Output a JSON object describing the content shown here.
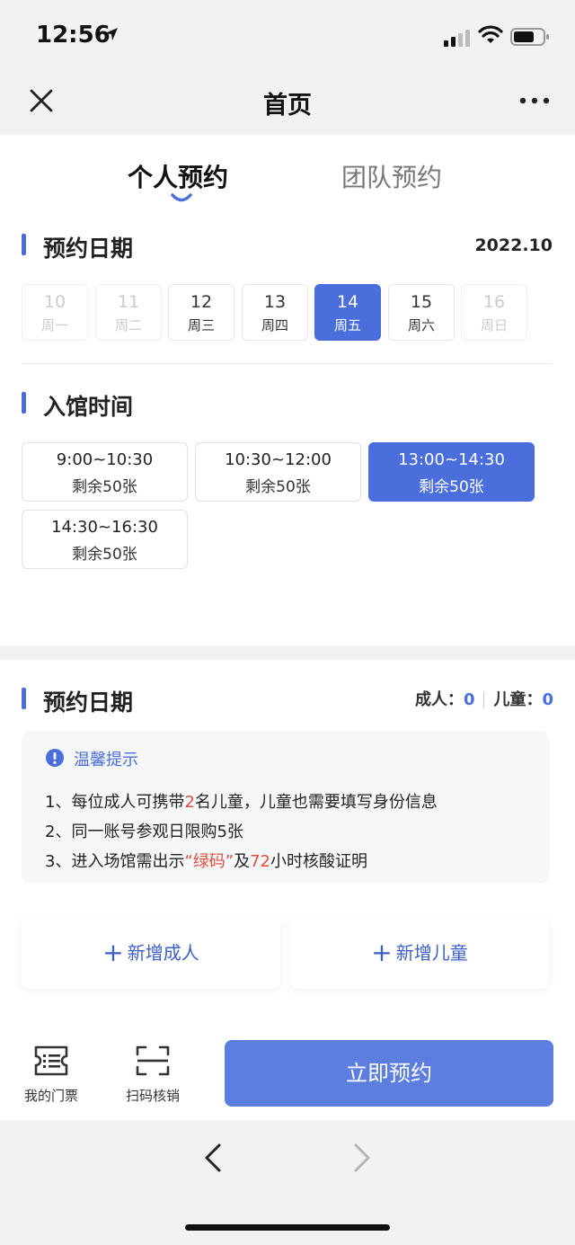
{
  "status_bar": {
    "time": "12:56"
  },
  "nav": {
    "title": "首页"
  },
  "tabs": [
    {
      "label": "个人预约",
      "active": true
    },
    {
      "label": "团队预约",
      "active": false
    }
  ],
  "date_section": {
    "title": "预约日期",
    "year_month": "2022.10",
    "dates": [
      {
        "num": "10",
        "week": "周一",
        "state": "disabled"
      },
      {
        "num": "11",
        "week": "周二",
        "state": "disabled"
      },
      {
        "num": "12",
        "week": "周三",
        "state": "normal"
      },
      {
        "num": "13",
        "week": "周四",
        "state": "normal"
      },
      {
        "num": "14",
        "week": "周五",
        "state": "selected"
      },
      {
        "num": "15",
        "week": "周六",
        "state": "normal"
      },
      {
        "num": "16",
        "week": "周日",
        "state": "disabled"
      }
    ]
  },
  "time_section": {
    "title": "入馆时间",
    "slots": [
      {
        "time": "9:00~10:30",
        "remaining": "剩余50张",
        "selected": false
      },
      {
        "time": "10:30~12:00",
        "remaining": "剩余50张",
        "selected": false
      },
      {
        "time": "13:00~14:30",
        "remaining": "剩余50张",
        "selected": true
      },
      {
        "time": "14:30~16:30",
        "remaining": "剩余50张",
        "selected": false
      }
    ]
  },
  "visitor_section": {
    "title": "预约日期",
    "adult_label": "成人：",
    "adult_count": "0",
    "child_label": "儿童：",
    "child_count": "0"
  },
  "notice": {
    "title": "温馨提示",
    "line1": {
      "a": "1、每位成人可携带",
      "b": "2",
      "c": "名儿童，儿童也需要填写身份信息"
    },
    "line2": "2、同一账号参观日限购5张",
    "line3": {
      "a": "3、进入场馆需出示",
      "b": "“绿码”",
      "c": "及",
      "d": "72",
      "e": "小时核酸证明"
    }
  },
  "actions": {
    "add_adult": "新增成人",
    "add_child": "新增儿童",
    "plus": "+"
  },
  "bottom_bar": {
    "my_tickets": "我的门票",
    "scan_verify": "扫码核销",
    "reserve": "立即预约"
  },
  "colors": {
    "accent": "#4a6fdc",
    "highlight_red": "#e04d3f"
  }
}
